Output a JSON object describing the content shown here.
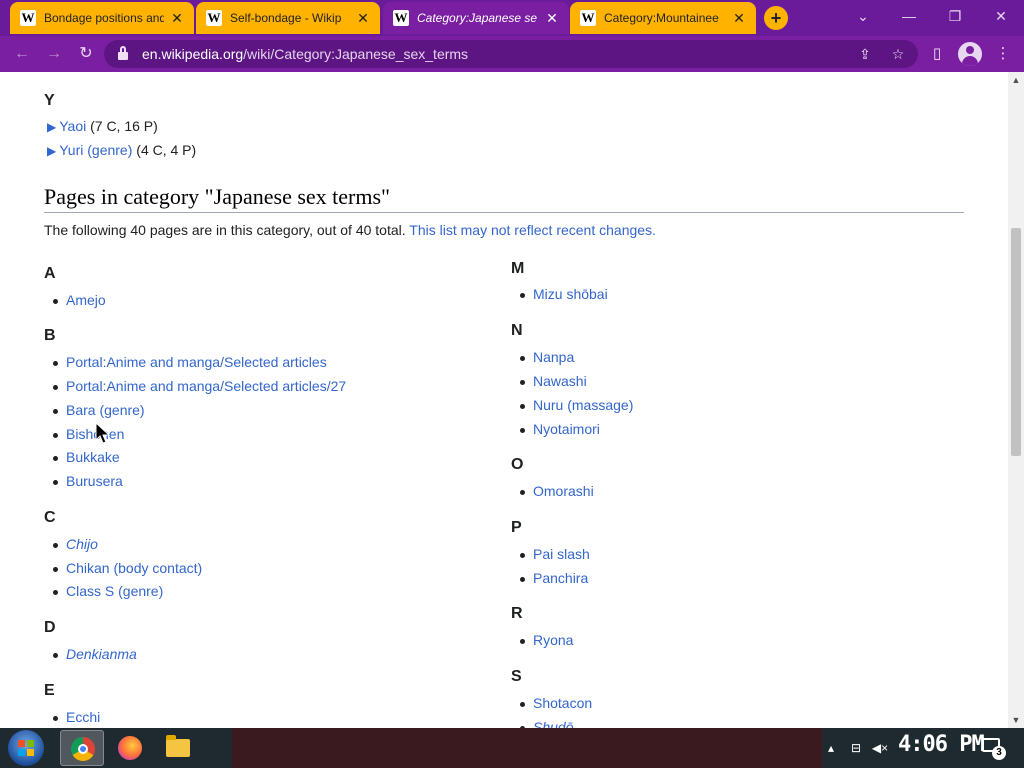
{
  "browser": {
    "tabs": [
      {
        "title": "Bondage positions and",
        "active": false
      },
      {
        "title": "Self-bondage - Wikip",
        "active": false
      },
      {
        "title": "Category:Japanese se",
        "active": true
      },
      {
        "title": "Category:Mountainee",
        "active": false
      }
    ],
    "favicon_letter": "W",
    "url_host": "en.wikipedia.org",
    "url_path": "/wiki/Category:Japanese_sex_terms",
    "new_tab": "+",
    "icons": {
      "back": "arrow-left-icon",
      "forward": "arrow-right-icon",
      "reload": "reload-icon",
      "lock": "lock-icon",
      "share": "share-icon",
      "bookmark": "star-icon",
      "side_panel": "side-panel-icon",
      "profile": "avatar-icon",
      "menu": "kebab-menu-icon"
    },
    "theme_color": "#7b1fa2",
    "accent_tab_color": "#ffb300"
  },
  "subcategories": {
    "letter": "Y",
    "items": [
      {
        "name": "Yaoi",
        "counts": "(7 C, 16 P)"
      },
      {
        "name": "Yuri (genre)",
        "counts": "(4 C, 4 P)"
      }
    ]
  },
  "pages_section": {
    "heading": "Pages in category \"Japanese sex terms\"",
    "intro": "The following 40 pages are in this category, out of 40 total.",
    "intro_link": "This list may not reflect recent changes.",
    "left_groups": [
      {
        "letter": "A",
        "items": [
          {
            "text": "Amejo",
            "italic": false
          }
        ]
      },
      {
        "letter": "B",
        "items": [
          {
            "text": "Portal:Anime and manga/Selected articles",
            "italic": false
          },
          {
            "text": "Portal:Anime and manga/Selected articles/27",
            "italic": false
          },
          {
            "text": "Bara (genre)",
            "italic": false
          },
          {
            "text": "Bishōnen",
            "italic": false
          },
          {
            "text": "Bukkake",
            "italic": false
          },
          {
            "text": "Burusera",
            "italic": false
          }
        ]
      },
      {
        "letter": "C",
        "items": [
          {
            "text": "Chijo",
            "italic": true
          },
          {
            "text": "Chikan (body contact)",
            "italic": false
          },
          {
            "text": "Class S (genre)",
            "italic": false
          }
        ]
      },
      {
        "letter": "D",
        "items": [
          {
            "text": "Denkianma",
            "italic": true
          }
        ]
      },
      {
        "letter": "E",
        "items": [
          {
            "text": "Ecchi",
            "italic": false
          }
        ]
      }
    ],
    "right_groups": [
      {
        "letter": "M",
        "items": [
          {
            "text": "Mizu shōbai",
            "italic": false
          }
        ]
      },
      {
        "letter": "N",
        "items": [
          {
            "text": "Nanpa",
            "italic": false
          },
          {
            "text": "Nawashi",
            "italic": false
          },
          {
            "text": "Nuru (massage)",
            "italic": false
          },
          {
            "text": "Nyotaimori",
            "italic": false
          }
        ]
      },
      {
        "letter": "O",
        "items": [
          {
            "text": "Omorashi",
            "italic": false
          }
        ]
      },
      {
        "letter": "P",
        "items": [
          {
            "text": "Pai slash",
            "italic": false
          },
          {
            "text": "Panchira",
            "italic": false
          }
        ]
      },
      {
        "letter": "R",
        "items": [
          {
            "text": "Ryona",
            "italic": false
          }
        ]
      },
      {
        "letter": "S",
        "items": [
          {
            "text": "Shotacon",
            "italic": false
          },
          {
            "text": "Shudō",
            "italic": true
          }
        ]
      }
    ],
    "link_color": "#3366cc"
  },
  "taskbar": {
    "clock": "4:06 PM",
    "notification_count": "3",
    "apps": [
      "chrome-icon",
      "firefox-icon",
      "file-explorer-icon"
    ],
    "tray_icons": [
      "show-hidden-icons-icon",
      "network-icon",
      "volume-muted-icon"
    ]
  }
}
